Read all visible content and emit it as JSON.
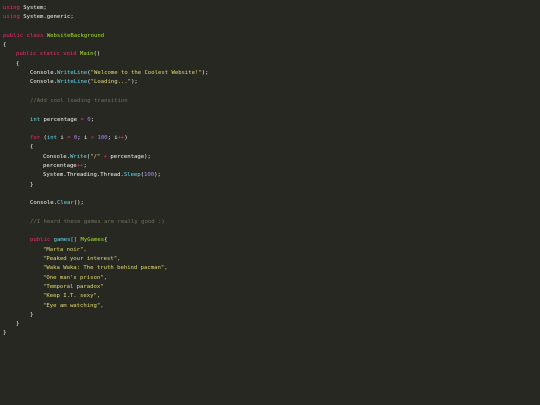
{
  "code": {
    "l1": {
      "kw": "using",
      "rest": " System;"
    },
    "l2": {
      "kw": "using",
      "rest": " System.generic;"
    },
    "l4": {
      "kw": "public",
      "kw2": "class",
      "name": "WebsiteBackground"
    },
    "l5": {
      "text": "{"
    },
    "l6": {
      "kw": "public",
      "kw2": "static",
      "ty": "void",
      "fn": "Main",
      "rest": "()"
    },
    "l7": {
      "text": "{"
    },
    "l8": {
      "obj": "Console.",
      "fn": "WriteLine",
      "p1": "(",
      "str": "\"Welcome to the Coolest Website!\"",
      "p2": ");"
    },
    "l9": {
      "obj": "Console.",
      "fn": "WriteLine",
      "p1": "(",
      "str": "\"Loading...\"",
      "p2": ");"
    },
    "l11": {
      "comment": "//Add cool loading transition"
    },
    "l13": {
      "ty": "int",
      "id": "percentage",
      "op": "=",
      "num": "0",
      "end": ";"
    },
    "l15": {
      "kw": "for",
      "p1": " (",
      "ty": "int",
      "id": " i",
      "op1": " =",
      "n1": " 0",
      "mid1": "; i",
      "op2": " <",
      "n2": " 100",
      "mid2": "; i",
      "op3": "++",
      "end": ")"
    },
    "l16": {
      "text": "{"
    },
    "l17": {
      "obj": "Console.",
      "fn": "Write",
      "p1": "(",
      "str": "\"/\"",
      "op": " +",
      "rest": " percentage);"
    },
    "l18": {
      "id": "percentage",
      "op": "++",
      "end": ";"
    },
    "l19": {
      "obj": "System.Threading.Thread.",
      "fn": "Sleep",
      "p1": "(",
      "num": "100",
      "p2": ");"
    },
    "l20": {
      "text": "}"
    },
    "l22": {
      "obj": "Console.",
      "fn": "Clear",
      "p1": "();"
    },
    "l24": {
      "comment": "//I heard these games are really good :)"
    },
    "l26": {
      "kw": "public",
      "ty": "games[]",
      "fn": "MyGames",
      "p1": "{"
    },
    "games": [
      "\"Marta noir\",",
      "\"Peaked your interest\",",
      "\"Waka Waka: The truth behind pacman\",",
      "\"One man's prison\",",
      "\"Temporal paradox\"",
      "\"Keep I.T. sexy\",",
      "\"Eye am watching\","
    ],
    "l34": {
      "text": "}"
    },
    "l35": {
      "text": "}"
    },
    "l36": {
      "text": "}"
    }
  }
}
